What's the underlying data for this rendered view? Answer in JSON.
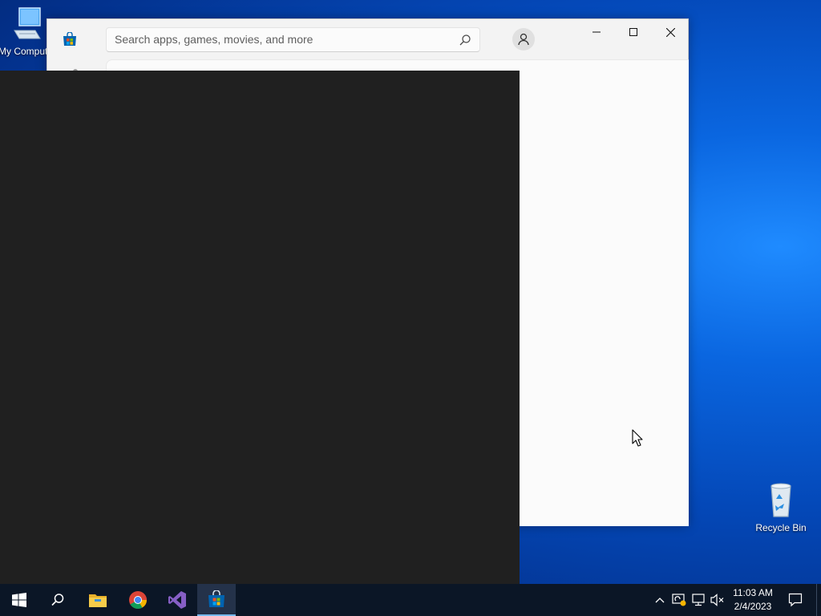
{
  "desktop": {
    "icons": [
      {
        "label": "My Computer",
        "icon": "computer-icon"
      },
      {
        "label": "Recycle Bin",
        "icon": "recycle-bin-icon"
      }
    ]
  },
  "store_window": {
    "search": {
      "placeholder": "Search apps, games, movies, and more",
      "value": ""
    },
    "controls": {
      "minimize": "minimize-icon",
      "maximize": "maximize-icon",
      "close": "close-icon"
    }
  },
  "taskbar": {
    "apps": [
      "start-icon",
      "search-icon",
      "file-explorer-icon",
      "chrome-icon",
      "visual-studio-icon",
      "microsoft-store-icon"
    ],
    "active_app": "microsoft-store-icon",
    "clock": {
      "time": "11:03 AM",
      "date": "2/4/2023"
    }
  },
  "colors": {
    "accent": "#0078d4",
    "taskbar": "#0b1626",
    "overlay": "#202020"
  }
}
